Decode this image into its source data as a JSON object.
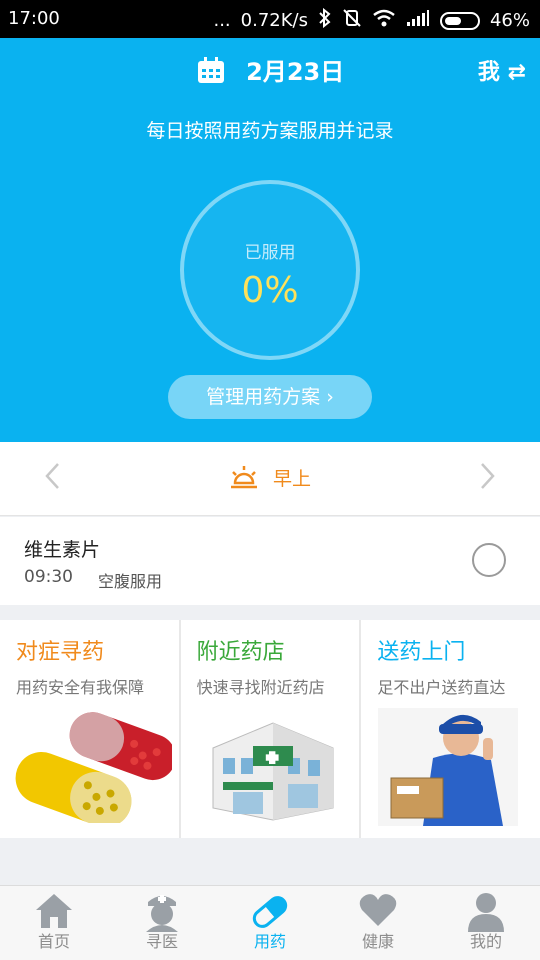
{
  "status_bar": {
    "time": "17:00",
    "dots": "...",
    "network_speed": "0.72K/s",
    "battery_percent": "46%"
  },
  "header": {
    "date": "2月23日",
    "user_switch": "我 ⇄",
    "subtitle": "每日按照用药方案服用并记录",
    "progress_label": "已服用",
    "progress_value": "0%",
    "progress_fraction": 0,
    "manage_button": "管理用药方案 ›"
  },
  "schedule": {
    "period": "早上"
  },
  "medication": {
    "name": "维生素片",
    "time": "09:30",
    "note": "空腹服用"
  },
  "cards": [
    {
      "title": "对症寻药",
      "subtitle": "用药安全有我保障",
      "color": "#f08a1c",
      "image": "capsules"
    },
    {
      "title": "附近药店",
      "subtitle": "快速寻找附近药店",
      "color": "#3aa83a",
      "image": "pharmacy-building"
    },
    {
      "title": "送药上门",
      "subtitle": "足不出户送药直达",
      "color": "#0ab2f0",
      "image": "delivery-man"
    }
  ],
  "bottom_nav": {
    "items": [
      {
        "label": "首页",
        "icon": "home-icon"
      },
      {
        "label": "寻医",
        "icon": "doctor-icon"
      },
      {
        "label": "用药",
        "icon": "pill-icon",
        "active": true
      },
      {
        "label": "健康",
        "icon": "heart-icon"
      },
      {
        "label": "我的",
        "icon": "user-icon"
      }
    ]
  },
  "colors": {
    "primary": "#0ab2f0",
    "accent_orange": "#f08a1c",
    "progress_text": "#ffe15a"
  }
}
